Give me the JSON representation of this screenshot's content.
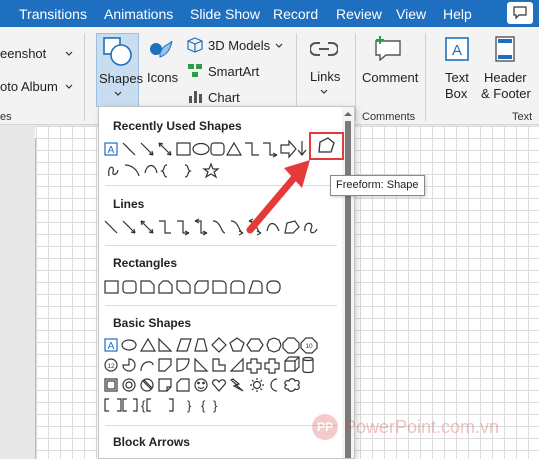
{
  "menu": {
    "tabs": [
      "Transitions",
      "Animations",
      "Slide Show",
      "Record",
      "Review",
      "View",
      "Help"
    ]
  },
  "ribbon": {
    "screenshot_label": "eenshot",
    "photo_album_label": "oto Album",
    "images_group_label": "es",
    "shapes_label": "Shapes",
    "icons_label": "Icons",
    "models_3d_label": "3D Models",
    "smartart_label": "SmartArt",
    "chart_label": "Chart",
    "links_label": "Links",
    "comment_label": "Comment",
    "comments_group_label": "Comments",
    "textbox_line1": "Text",
    "textbox_line2": "Box",
    "header_line1": "Header",
    "header_line2": "& Footer",
    "text_group_label": "Text"
  },
  "dropdown": {
    "sections": {
      "recent": "Recently Used Shapes",
      "lines": "Lines",
      "rectangles": "Rectangles",
      "basic": "Basic Shapes",
      "block_arrows": "Block Arrows"
    },
    "basic_misc_row": [
      "{",
      "}",
      "[",
      "]",
      "{",
      "}",
      "[",
      "]"
    ],
    "text_box_letter": "A",
    "octagon_numbers": [
      "12",
      "10"
    ]
  },
  "tooltip": {
    "text": "Freeform: Shape"
  },
  "watermark": {
    "logo": "PP",
    "text": "PowerPoint.com.vn"
  },
  "colors": {
    "menubar_bg": "#1e6fc0",
    "annotation_red": "#e53a3a",
    "shape_blue": "#1e6fc0"
  }
}
